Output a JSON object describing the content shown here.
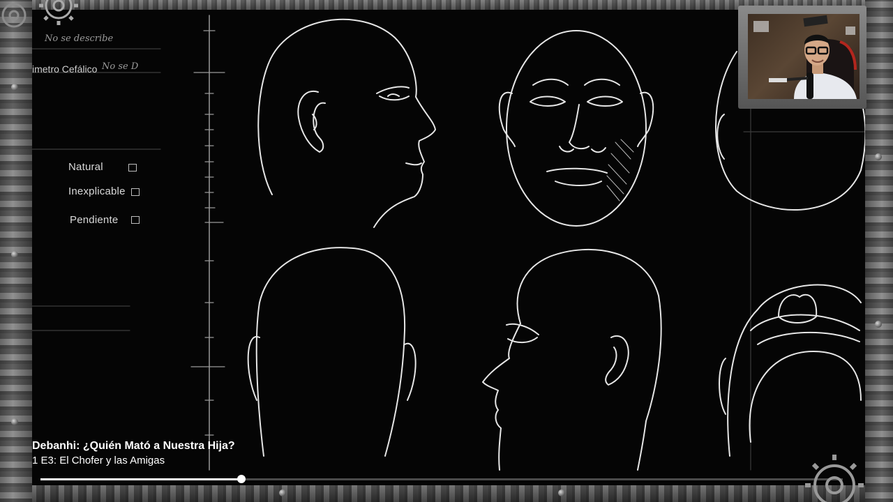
{
  "player": {
    "show_title": "Debanhi: ¿Quién Mató a Nuestra Hija?",
    "episode_title": "1 E3:  El Chofer y las Amigas",
    "progress": 0.25
  },
  "form": {
    "field_top": "No se describe",
    "field_perimetro_label": "imetro Cefálico",
    "field_perimetro_value": "No se D",
    "checkboxes": [
      {
        "label": "Natural"
      },
      {
        "label": "Inexplicable"
      },
      {
        "label": "Pendiente"
      }
    ]
  },
  "colors": {
    "chalk": "#e6e6e6",
    "frame_metal": "#7c7c7c",
    "progress_fill": "#ffffff"
  },
  "icons": [
    "gear-icon",
    "rivet-icon"
  ]
}
